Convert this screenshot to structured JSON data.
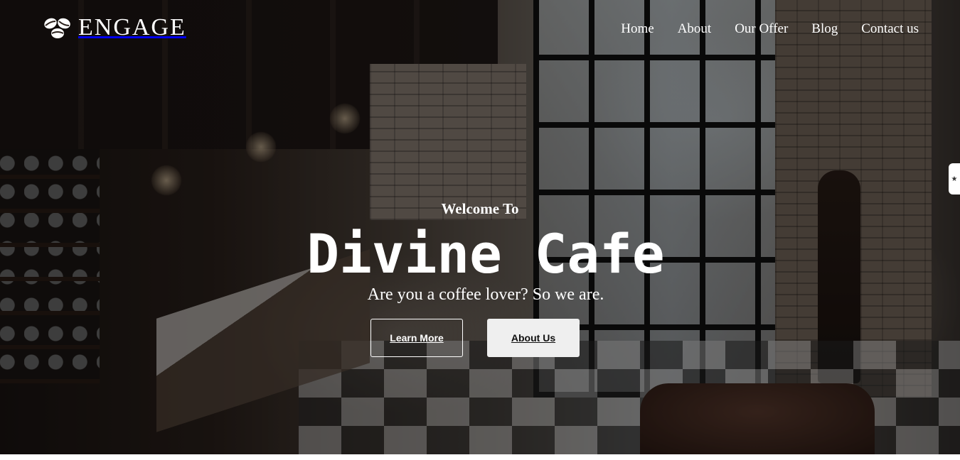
{
  "brand": {
    "name": "ENGAGE",
    "logo_icon": "coffee-beans-icon"
  },
  "nav": {
    "items": [
      {
        "label": "Home"
      },
      {
        "label": "About"
      },
      {
        "label": "Our Offer"
      },
      {
        "label": "Blog"
      },
      {
        "label": "Contact us"
      }
    ]
  },
  "hero": {
    "kicker": "Welcome To",
    "title": "Divine Cafe",
    "subtitle": "Are you a coffee lover? So we are.",
    "buttons": {
      "learn_more": "Learn More",
      "about_us": "About Us"
    }
  },
  "side_tab": {
    "icon": "star-icon",
    "glyph": "★"
  },
  "colors": {
    "text": "#ffffff",
    "button_solid_bg": "#efefef",
    "button_solid_text": "#111111"
  }
}
